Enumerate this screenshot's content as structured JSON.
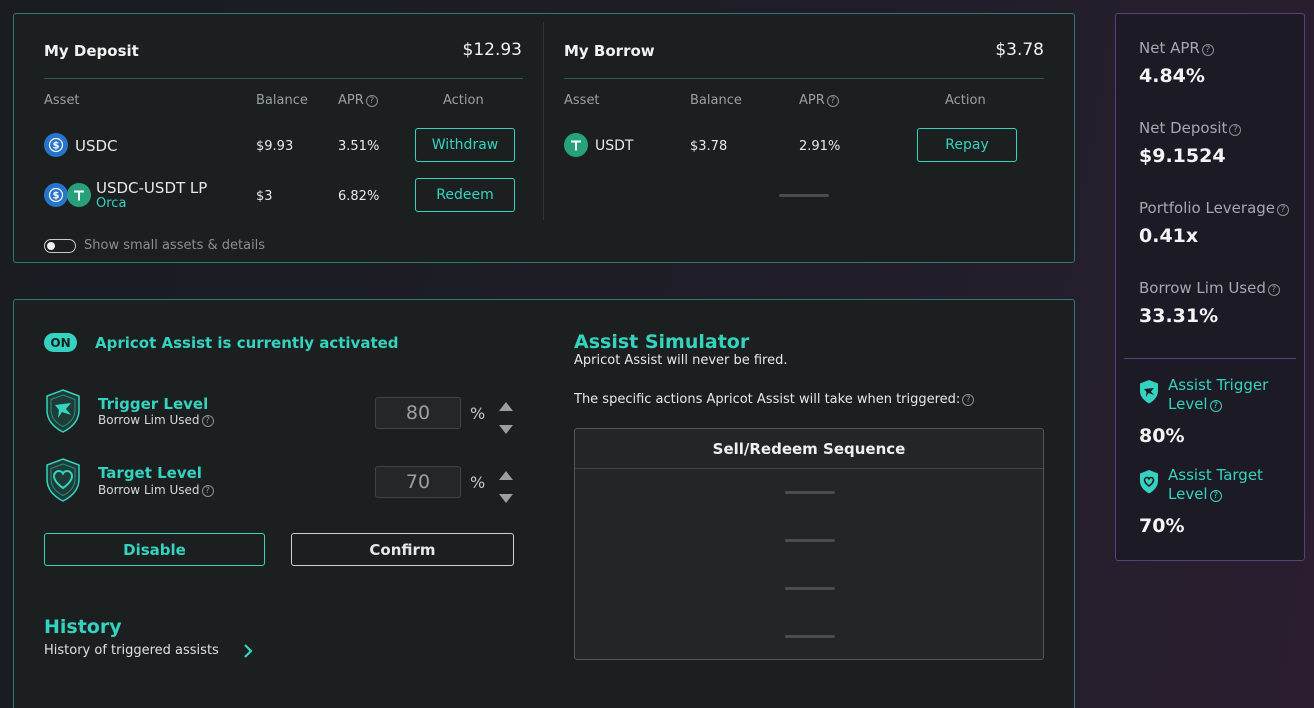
{
  "deposit": {
    "title": "My Deposit",
    "total": "$12.93",
    "headers": {
      "asset": "Asset",
      "balance": "Balance",
      "apr": "APR",
      "action": "Action"
    },
    "rows": [
      {
        "asset": "USDC",
        "sub": "",
        "balance": "$9.93",
        "apr": "3.51%",
        "action": "Withdraw"
      },
      {
        "asset": "USDC-USDT LP",
        "sub": "Orca",
        "balance": "$3",
        "apr": "6.82%",
        "action": "Redeem"
      }
    ],
    "toggle_label": "Show small assets & details"
  },
  "borrow": {
    "title": "My Borrow",
    "total": "$3.78",
    "headers": {
      "asset": "Asset",
      "balance": "Balance",
      "apr": "APR",
      "action": "Action"
    },
    "rows": [
      {
        "asset": "USDT",
        "balance": "$3.78",
        "apr": "2.91%",
        "action": "Repay"
      }
    ]
  },
  "assist": {
    "badge": "ON",
    "status": "Apricot Assist is currently activated",
    "trigger": {
      "title": "Trigger Level",
      "sub": "Borrow Lim Used",
      "value": "80",
      "unit": "%"
    },
    "target": {
      "title": "Target Level",
      "sub": "Borrow Lim Used",
      "value": "70",
      "unit": "%"
    },
    "disable_label": "Disable",
    "confirm_label": "Confirm",
    "history_title": "History",
    "history_sub": "History of triggered assists"
  },
  "simulator": {
    "title": "Assist Simulator",
    "note": "Apricot Assist will never be fired.",
    "actions_label": "The specific actions Apricot Assist will take when triggered:",
    "table_title": "Sell/Redeem Sequence"
  },
  "stats": {
    "net_apr": {
      "label": "Net APR",
      "value": "4.84%"
    },
    "net_deposit": {
      "label": "Net Deposit",
      "value": "$9.1524"
    },
    "leverage": {
      "label": "Portfolio Leverage",
      "value": "0.41x"
    },
    "borrow_lim": {
      "label": "Borrow Lim Used",
      "value": "33.31%"
    },
    "assist_trigger": {
      "label_line1": "Assist Trigger",
      "label_line2": "Level",
      "value": "80%"
    },
    "assist_target": {
      "label_line1": "Assist Target",
      "label_line2": "Level",
      "value": "70%"
    }
  },
  "colors": {
    "accent": "#35d3bf",
    "usdc": "#2775ca",
    "usdt": "#26a17b",
    "stats_border": "#5b3f7a"
  }
}
